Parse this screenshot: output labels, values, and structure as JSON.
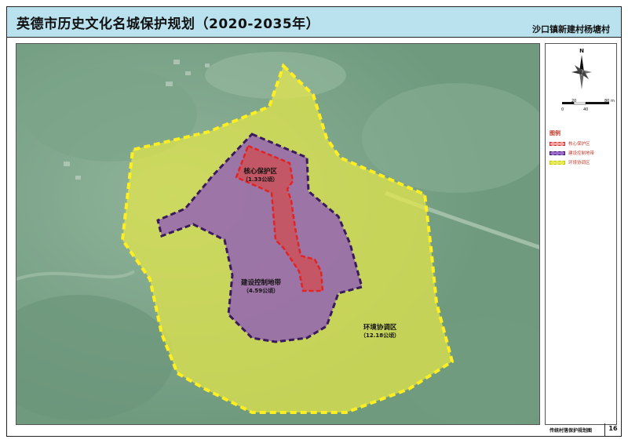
{
  "header": {
    "title": "英德市历史文化名城保护规划（2020-2035年）",
    "subtitle": "沙口镇新建村杨塘村"
  },
  "map": {
    "zones": [
      {
        "name": "核心保护区",
        "area": "（1.33公顷）",
        "color": "#d72a2a"
      },
      {
        "name": "建设控制地带",
        "area": "（4.59公顷）",
        "color": "#6b2d96"
      },
      {
        "name": "环境协调区",
        "area": "（12.18公顷）",
        "color": "#e8ea3a"
      }
    ]
  },
  "compass": {
    "north_label": "N"
  },
  "scale_bar": {
    "labels": [
      "0",
      "20",
      "40",
      "80 m"
    ]
  },
  "legend": {
    "title": "图例",
    "items": [
      {
        "label": "核心保护区"
      },
      {
        "label": "建设控制地带"
      },
      {
        "label": "环境协调区"
      }
    ]
  },
  "footer": {
    "title": "传统村落保护规划图",
    "page": "16"
  }
}
